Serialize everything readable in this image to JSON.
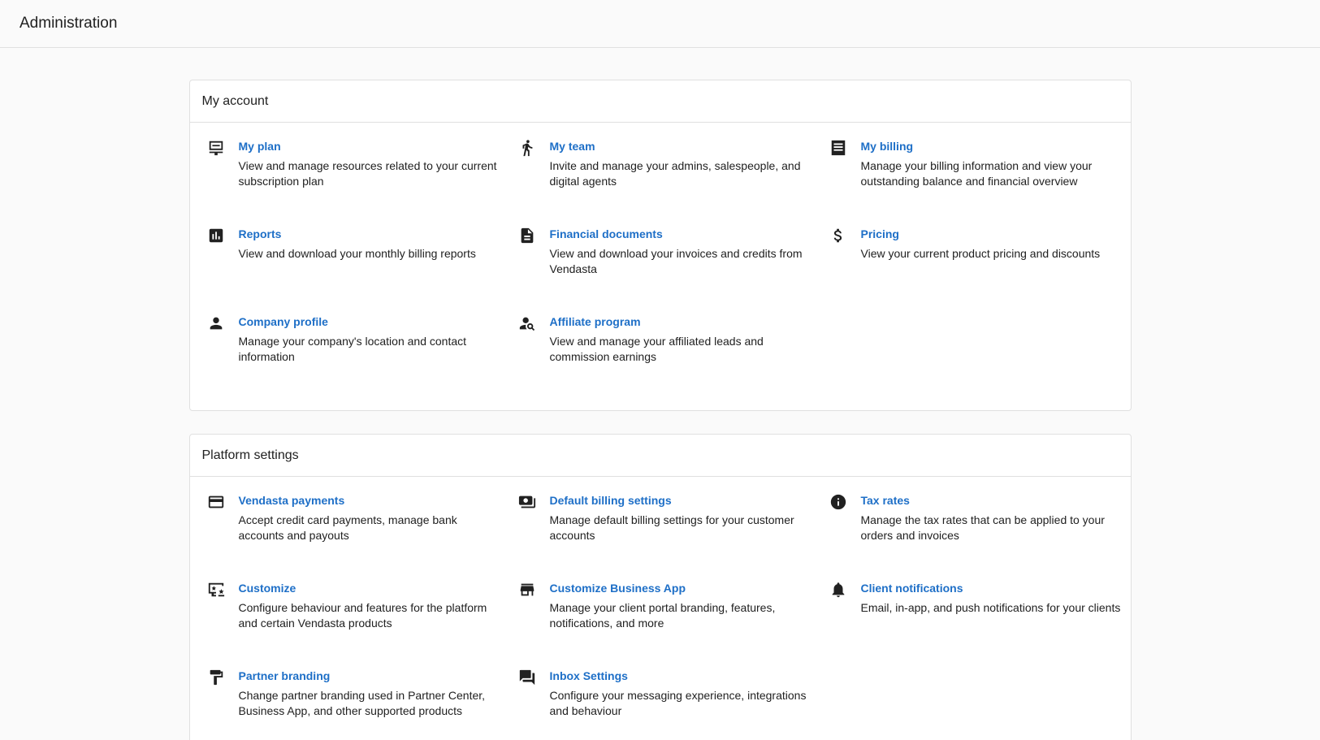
{
  "page": {
    "title": "Administration"
  },
  "sections": [
    {
      "title": "My account",
      "items": [
        {
          "title": "My plan",
          "desc": "View and manage resources related to your current subscription plan",
          "icon": "plan-icon"
        },
        {
          "title": "My team",
          "desc": "Invite and manage your admins, salespeople, and digital agents",
          "icon": "team-icon"
        },
        {
          "title": "My billing",
          "desc": "Manage your billing information and view your outstanding balance and financial overview",
          "icon": "billing-icon"
        },
        {
          "title": "Reports",
          "desc": "View and download your monthly billing reports",
          "icon": "reports-icon"
        },
        {
          "title": "Financial documents",
          "desc": "View and download your invoices and credits from Vendasta",
          "icon": "document-icon"
        },
        {
          "title": "Pricing",
          "desc": "View your current product pricing and discounts",
          "icon": "dollar-icon"
        },
        {
          "title": "Company profile",
          "desc": "Manage your company's location and contact information",
          "icon": "person-icon"
        },
        {
          "title": "Affiliate program",
          "desc": "View and manage your affiliated leads and commission earnings",
          "icon": "person-search-icon"
        }
      ]
    },
    {
      "title": "Platform settings",
      "items": [
        {
          "title": "Vendasta payments",
          "desc": "Accept credit card payments, manage bank accounts and payouts",
          "icon": "credit-card-icon"
        },
        {
          "title": "Default billing settings",
          "desc": "Manage default billing settings for your customer accounts",
          "icon": "payments-icon"
        },
        {
          "title": "Tax rates",
          "desc": "Manage the tax rates that can be applied to your orders and invoices",
          "icon": "info-icon"
        },
        {
          "title": "Customize",
          "desc": "Configure behaviour and features for the platform and certain Vendasta products",
          "icon": "screen-customize-icon"
        },
        {
          "title": "Customize Business App",
          "desc": "Manage your client portal branding, features, notifications, and more",
          "icon": "storefront-icon"
        },
        {
          "title": "Client notifications",
          "desc": "Email, in-app, and push notifications for your clients",
          "icon": "bell-icon"
        },
        {
          "title": "Partner branding",
          "desc": "Change partner branding used in Partner Center, Business App, and other supported products",
          "icon": "paint-roller-icon"
        },
        {
          "title": "Inbox Settings",
          "desc": "Configure your messaging experience, integrations and behaviour",
          "icon": "forum-icon"
        }
      ]
    }
  ]
}
